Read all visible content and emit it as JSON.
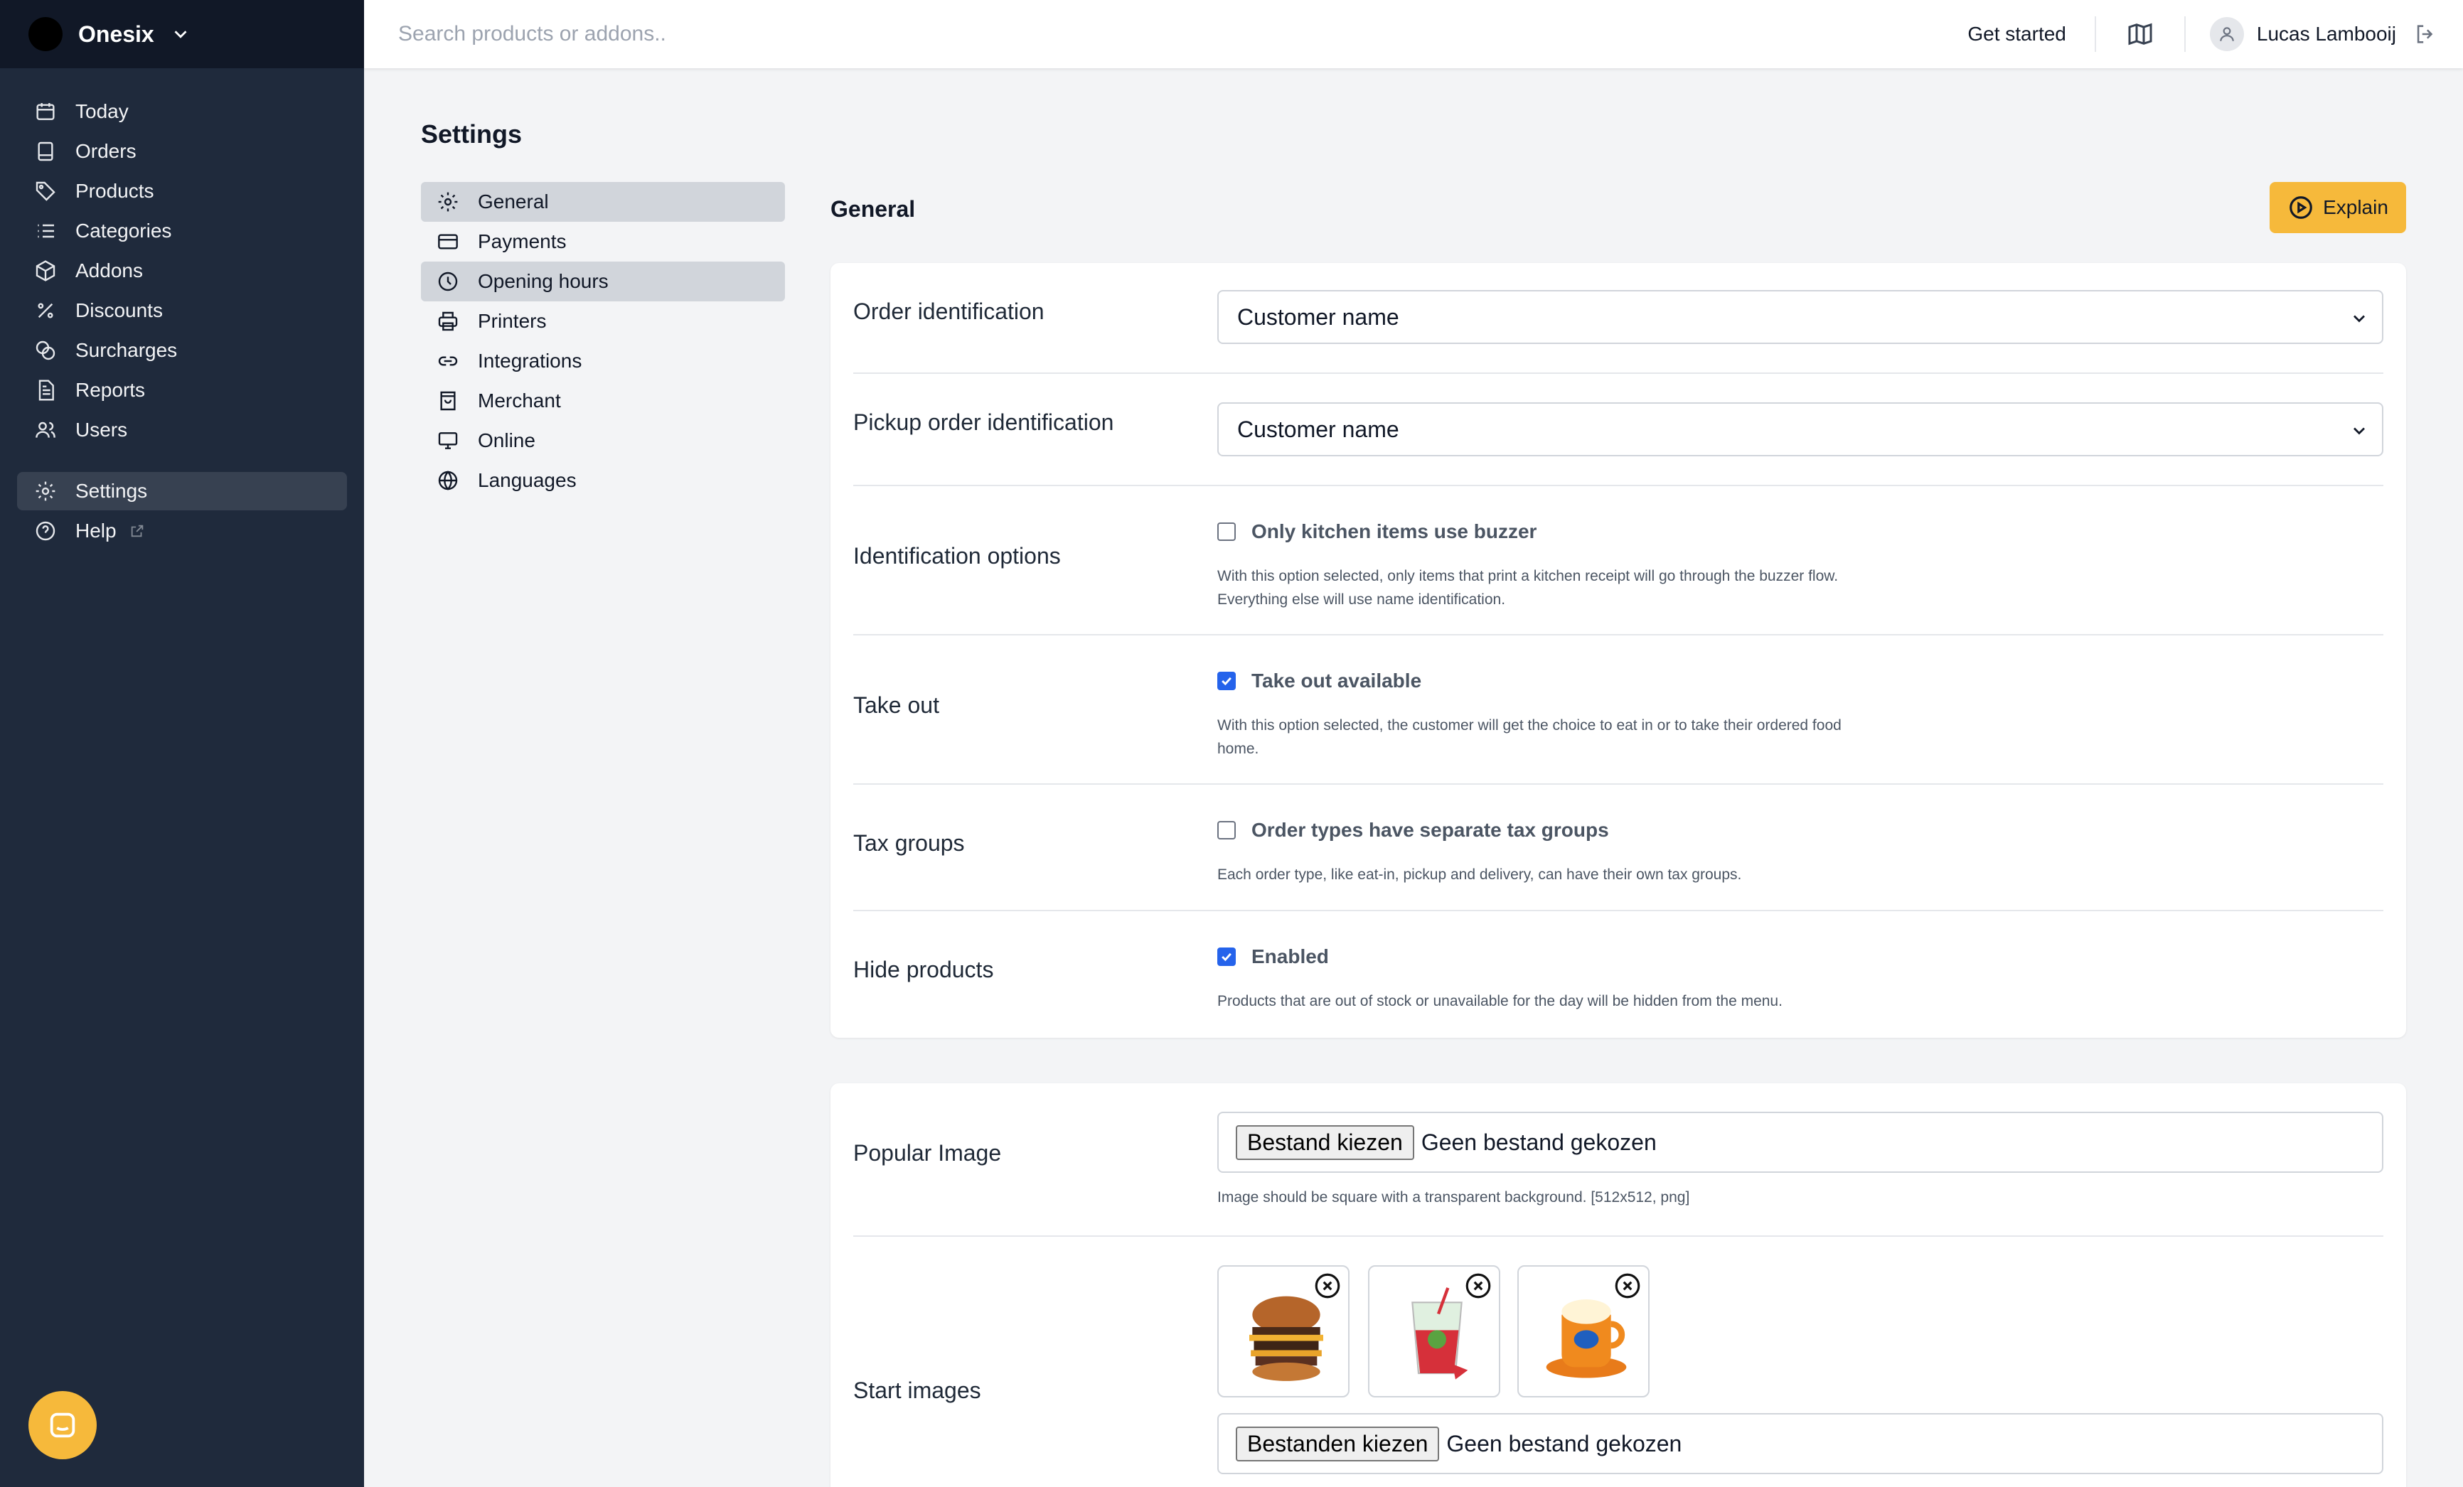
{
  "app": {
    "name": "Onesix"
  },
  "sidebar": {
    "items": [
      {
        "label": "Today",
        "icon": "calendar-icon"
      },
      {
        "label": "Orders",
        "icon": "receipt-icon"
      },
      {
        "label": "Products",
        "icon": "tag-icon"
      },
      {
        "label": "Categories",
        "icon": "list-icon"
      },
      {
        "label": "Addons",
        "icon": "cube-icon"
      },
      {
        "label": "Discounts",
        "icon": "percent-icon"
      },
      {
        "label": "Surcharges",
        "icon": "coins-icon"
      },
      {
        "label": "Reports",
        "icon": "document-icon"
      },
      {
        "label": "Users",
        "icon": "users-icon"
      }
    ],
    "settings_label": "Settings",
    "help_label": "Help"
  },
  "topbar": {
    "search_placeholder": "Search products or addons..",
    "get_started": "Get started",
    "user_name": "Lucas Lambooij"
  },
  "page": {
    "title": "Settings",
    "section_title": "General",
    "explain_label": "Explain"
  },
  "subnav": {
    "items": [
      {
        "label": "General",
        "icon": "gear-icon",
        "active": true
      },
      {
        "label": "Payments",
        "icon": "credit-card-icon",
        "active": false
      },
      {
        "label": "Opening hours",
        "icon": "clock-icon",
        "active": true
      },
      {
        "label": "Printers",
        "icon": "printer-icon",
        "active": false
      },
      {
        "label": "Integrations",
        "icon": "link-icon",
        "active": false
      },
      {
        "label": "Merchant",
        "icon": "shopping-bag-icon",
        "active": false
      },
      {
        "label": "Online",
        "icon": "monitor-icon",
        "active": false
      },
      {
        "label": "Languages",
        "icon": "globe-icon",
        "active": false
      }
    ]
  },
  "general": {
    "order_identification": {
      "label": "Order identification",
      "value": "Customer name"
    },
    "pickup_identification": {
      "label": "Pickup order identification",
      "value": "Customer name"
    },
    "identification_options": {
      "label": "Identification options",
      "checkbox_label": "Only kitchen items use buzzer",
      "checked": false,
      "help": "With this option selected, only items that print a kitchen receipt will go through the buzzer flow. Everything else will use name identification."
    },
    "take_out": {
      "label": "Take out",
      "checkbox_label": "Take out available",
      "checked": true,
      "help": "With this option selected, the customer will get the choice to eat in or to take their ordered food home."
    },
    "tax_groups": {
      "label": "Tax groups",
      "checkbox_label": "Order types have separate tax groups",
      "checked": false,
      "help": "Each order type, like eat-in, pickup and delivery, can have their own tax groups."
    },
    "hide_products": {
      "label": "Hide products",
      "checkbox_label": "Enabled",
      "checked": true,
      "help": "Products that are out of stock or unavailable for the day will be hidden from the menu."
    }
  },
  "images": {
    "popular": {
      "label": "Popular Image",
      "button": "Bestand kiezen",
      "status": "Geen bestand gekozen",
      "help": "Image should be square with a transparent background. [512x512, png]"
    },
    "start": {
      "label": "Start images",
      "thumbnails": [
        "burger-image",
        "drink-image",
        "mug-image"
      ],
      "button": "Bestanden kiezen",
      "status": "Geen bestand gekozen"
    }
  },
  "colors": {
    "sidebar_bg": "#1f2a3c",
    "brand_bg": "#111827",
    "accent": "#f6b93b",
    "checkbox": "#2563eb"
  }
}
